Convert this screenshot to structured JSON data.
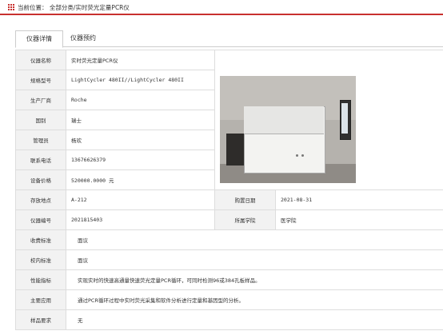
{
  "breadcrumb": {
    "prefix": "当前位置：",
    "path": "全部分类/实时荧光定量PCR仪"
  },
  "tabs": [
    {
      "label": "仪器详情",
      "active": true
    },
    {
      "label": "仪器预约",
      "active": false
    }
  ],
  "details": {
    "name": {
      "label": "仪器名称",
      "value": "实时荧光定量PCR仪"
    },
    "model": {
      "label": "规格型号",
      "value": "LightCycler 480II//LightCycler 480II"
    },
    "maker": {
      "label": "生产厂商",
      "value": "Roche"
    },
    "country": {
      "label": "国别",
      "value": "瑞士"
    },
    "manager": {
      "label": "管理员",
      "value": "杨欢"
    },
    "phone": {
      "label": "联系电话",
      "value": "13676626379"
    },
    "price": {
      "label": "设备价格",
      "value": "520000.0000 元"
    },
    "location": {
      "label": "存放地点",
      "value": "A-212"
    },
    "purchase_date": {
      "label": "购置日期",
      "value": "2021-08-31"
    },
    "number": {
      "label": "仪器编号",
      "value": "2021815403"
    },
    "college": {
      "label": "所属学院",
      "value": "医学院"
    },
    "fee_standard": {
      "label": "收费标准",
      "value": "面议"
    },
    "internal_standard": {
      "label": "校内标准",
      "value": "面议"
    },
    "performance": {
      "label": "性能指标",
      "value": "实现实时的快速高通量快速荧光定量PCR循环，可同时检测96或384孔板样品。"
    },
    "application": {
      "label": "主要应用",
      "value": "通过PCR循环过程中实时荧光采集和软件分析进行定量和基因型的分析。"
    },
    "sample": {
      "label": "样品要求",
      "value": "无"
    }
  },
  "colors": {
    "accent": "#c8302e",
    "label_bg": "#f2f2f2",
    "border": "#dddddd"
  },
  "image": {
    "icon": "instrument-photo"
  }
}
